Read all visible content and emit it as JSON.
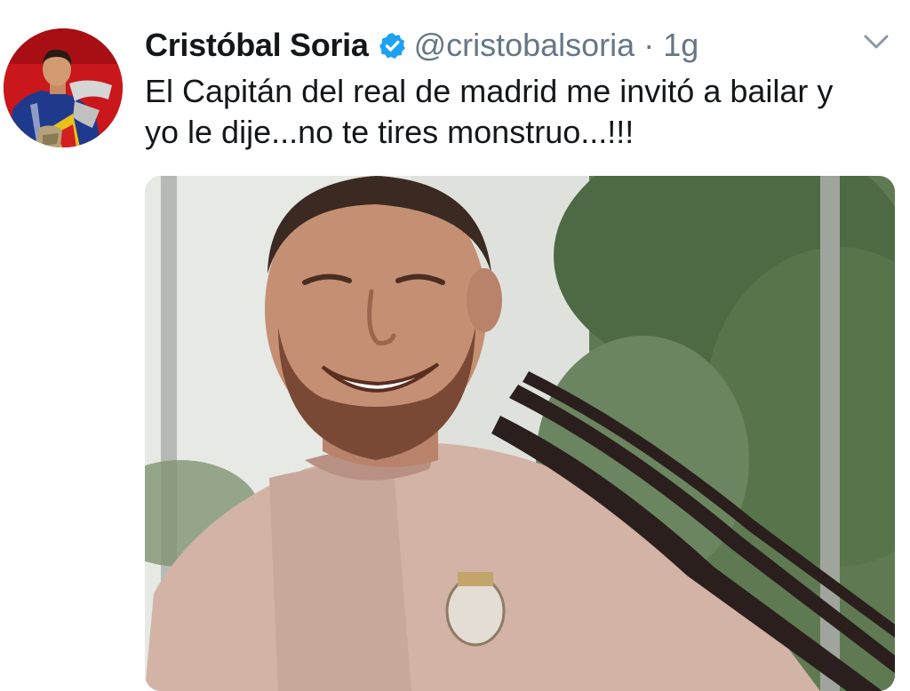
{
  "tweet": {
    "author_name": "Cristóbal Soria",
    "handle": "@cristobalsoria",
    "separator": "·",
    "time": "1g",
    "text": "El Capitán del real de madrid me invitó a bailar y yo le dije...no te tires monstruo...!!!",
    "verified": true
  },
  "icons": {
    "verified": "verified-badge-icon",
    "more": "chevron-down-icon"
  },
  "colors": {
    "text_primary": "#14171a",
    "text_secondary": "#657786",
    "verified_blue": "#1da1f2",
    "avatar_background": "#c41818"
  }
}
